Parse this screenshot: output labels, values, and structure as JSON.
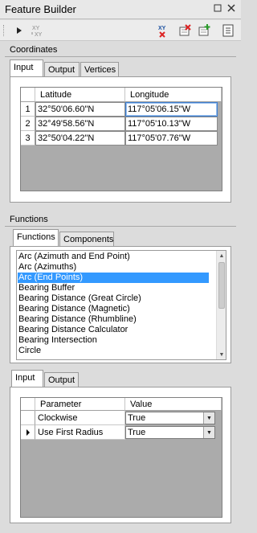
{
  "window": {
    "title": "Feature Builder",
    "pin_icon": "▫",
    "close_icon": "✕"
  },
  "toolbar": {
    "tools": [
      "play-icon",
      "swap-xy-icon",
      "xy-delete-icon",
      "clear-icon",
      "add-point-icon",
      "properties-icon"
    ]
  },
  "coordinates": {
    "label": "Coordinates",
    "tabs": [
      "Input",
      "Output",
      "Vertices"
    ],
    "active_tab": "Input",
    "columns": [
      "Latitude",
      "Longitude"
    ],
    "rows": [
      {
        "num": "1",
        "lat": "32°50'06.60\"N",
        "lon": "117°05'06.15\"W"
      },
      {
        "num": "2",
        "lat": "32°49'58.56\"N",
        "lon": "117°05'10.13\"W"
      },
      {
        "num": "3",
        "lat": "32°50'04.22\"N",
        "lon": "117°05'07.76\"W"
      }
    ]
  },
  "functions": {
    "label": "Functions",
    "tabs": [
      "Functions",
      "Components"
    ],
    "active_tab": "Functions",
    "items": [
      "Arc (Azimuth and End Point)",
      "Arc (Azimuths)",
      "Arc (End Points)",
      "Bearing Buffer",
      "Bearing Distance (Great Circle)",
      "Bearing Distance (Magnetic)",
      "Bearing Distance (Rhumbline)",
      "Bearing Distance Calculator",
      "Bearing Intersection",
      "Circle"
    ],
    "selected_index": 2
  },
  "parameters": {
    "tabs": [
      "Input",
      "Output"
    ],
    "active_tab": "Input",
    "columns": [
      "Parameter",
      "Value"
    ],
    "rows": [
      {
        "name": "Clockwise",
        "value": "True"
      },
      {
        "name": "Use First Radius",
        "value": "True"
      }
    ]
  },
  "colors": {
    "selection": "#3399ff",
    "background": "#dcdcdc"
  }
}
